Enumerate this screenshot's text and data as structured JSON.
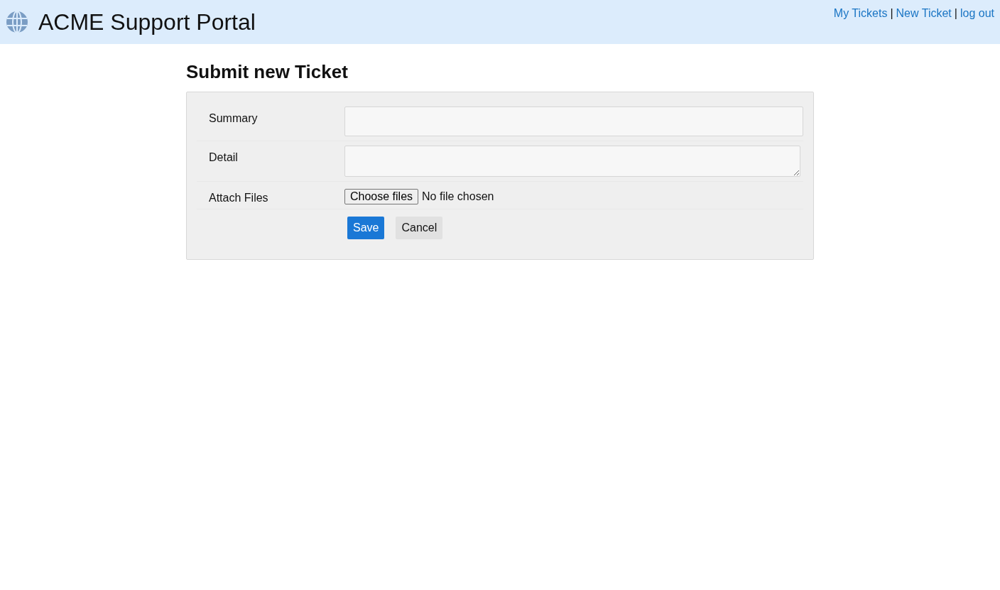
{
  "header": {
    "title": "ACME Support Portal",
    "nav": [
      {
        "label": "My Tickets"
      },
      {
        "label": "New Ticket"
      },
      {
        "label": "log out"
      }
    ],
    "separator": "|"
  },
  "page_title": "Submit new Ticket",
  "form": {
    "fields": [
      {
        "kind": "text",
        "label": "Summary"
      },
      {
        "kind": "textarea",
        "label": "Detail"
      },
      {
        "kind": "file",
        "label": "Attach Files",
        "button": "Choose files",
        "status": "No file chosen"
      }
    ],
    "buttons": [
      {
        "kind": "primary",
        "label": "Save"
      },
      {
        "kind": "secondary",
        "label": "Cancel"
      }
    ]
  }
}
